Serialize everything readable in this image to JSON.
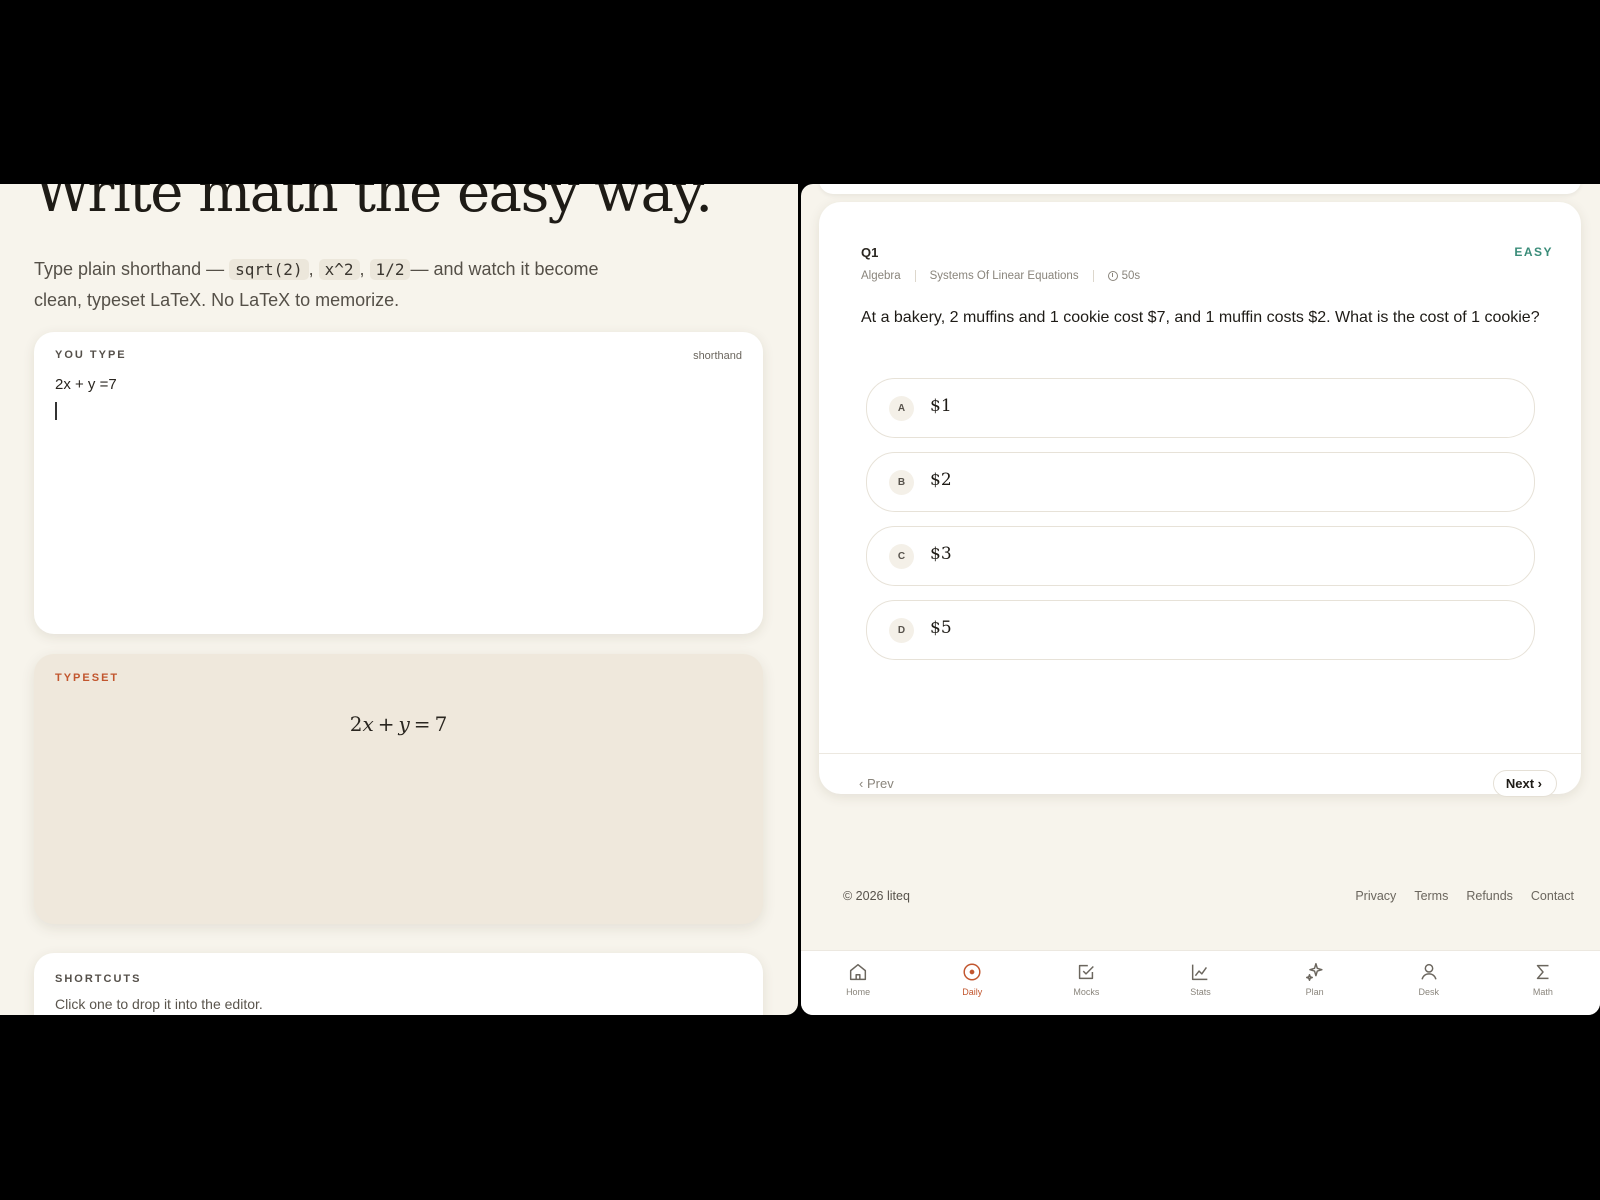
{
  "hero": {
    "title": "Write math the easy way.",
    "sub_1": "Type plain shorthand —",
    "code_1": "sqrt(2)",
    "comma_1": ",",
    "code_2": "x^2",
    "comma_2": ",",
    "code_3": "1/2",
    "sub_2": "— and watch it become clean, typeset LaTeX. No LaTeX to memorize."
  },
  "editor": {
    "caption": "YOU TYPE",
    "mode": "shorthand",
    "value": "2x + y =7"
  },
  "typeset": {
    "caption": "TYPESET",
    "formula": "2x + y = 7"
  },
  "shortcuts": {
    "caption": "SHORTCUTS",
    "description": "Click one to drop it into the editor."
  },
  "question": {
    "number": "Q1",
    "difficulty": "EASY",
    "subject": "Algebra",
    "topic": "Systems Of Linear Equations",
    "time": "50s",
    "text": "At a bakery, 2 muffins and 1 cookie cost $7, and 1 muffin costs $2. What is the cost of 1 cookie?",
    "options": [
      {
        "letter": "A",
        "value": "$1"
      },
      {
        "letter": "B",
        "value": "$2"
      },
      {
        "letter": "C",
        "value": "$3"
      },
      {
        "letter": "D",
        "value": "$5"
      }
    ],
    "prev_label": "Prev",
    "next_label": "Next"
  },
  "footer": {
    "copyright": "© 2026 liteq",
    "links": [
      "Privacy",
      "Terms",
      "Refunds",
      "Contact"
    ]
  },
  "tabbar": {
    "active": "Daily",
    "accent": "#c2562e",
    "items": [
      {
        "label": "Home",
        "icon": "home-icon"
      },
      {
        "label": "Daily",
        "icon": "target-icon"
      },
      {
        "label": "Mocks",
        "icon": "checkbox-icon"
      },
      {
        "label": "Stats",
        "icon": "chart-icon"
      },
      {
        "label": "Plan",
        "icon": "sparkle-icon"
      },
      {
        "label": "Desk",
        "icon": "user-icon"
      },
      {
        "label": "Math",
        "icon": "sigma-icon"
      }
    ]
  }
}
